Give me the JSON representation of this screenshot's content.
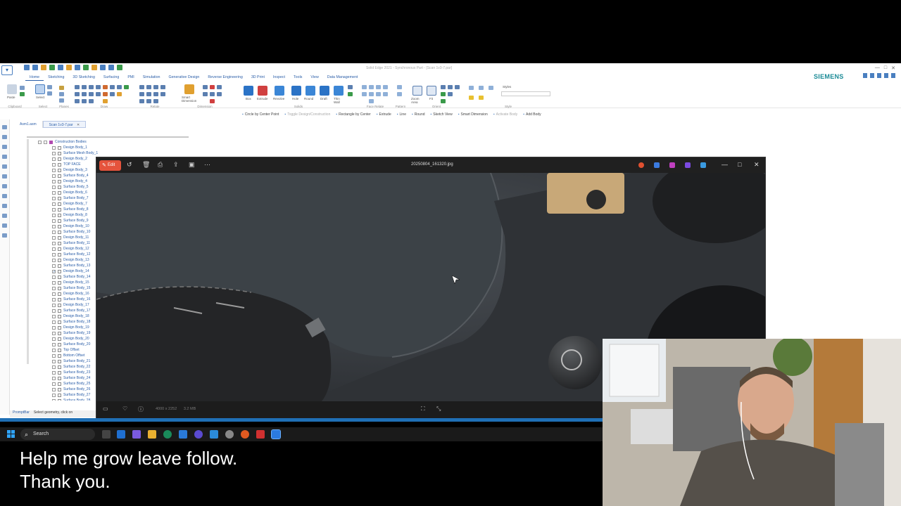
{
  "solid_edge": {
    "window_title": "Solid Edge 2021 - Synchronous Part - [Scan 1v3-7.par]",
    "brand": "SIEMENS",
    "tabs": [
      "Home",
      "Sketching",
      "3D Sketching",
      "Surfacing",
      "PMI",
      "Simulation",
      "Generative Design",
      "Reverse Engineering",
      "3D Print",
      "Inspect",
      "Tools",
      "View",
      "Data Management"
    ],
    "ribbon_groups": [
      "Clipboard",
      "Select",
      "Planes",
      "Draw",
      "Relate",
      "Dimension",
      "Solids",
      "Face Relate",
      "Pattern",
      "Orient",
      "Style"
    ],
    "ribbon_buttons": {
      "paste": "Paste",
      "select": "Select",
      "smart_dimension": "Smart Dimension",
      "box": "Box",
      "extrude": "Extrude",
      "revolve": "Revolve",
      "hole": "Hole",
      "round": "Round",
      "draft": "Draft",
      "thin_wall": "Thin Wall",
      "zoom_area": "Zoom Area",
      "fit": "Fit",
      "styles": "Styles"
    },
    "command_bar": [
      "Circle by Center Point",
      "Toggle Design/Construction",
      "Rectangle by Center",
      "Extrude",
      "Line",
      "Round",
      "Sketch View",
      "Smart Dimension",
      "Activate Body",
      "Add Body"
    ],
    "doc_tabs": [
      "Asm1.asm",
      "Scan 1v3-7.par"
    ],
    "tree": {
      "root": "Construction Bodies",
      "items": [
        "Design Body_1",
        "Surface Mesh Body_1",
        "Design Body_2",
        "TOP FACE",
        "Design Body_3",
        "Surface Body_4",
        "Design Body_4",
        "Surface Body_5",
        "Design Body_6",
        "Surface Body_7",
        "Design Body_7",
        "Surface Body_8",
        "Design Body_8",
        "Surface Body_9",
        "Design Body_10",
        "Surface Body_10",
        "Design Body_11",
        "Surface Body_11",
        "Design Body_12",
        "Surface Body_12",
        "Design Body_13",
        "Surface Body_13",
        "Design Body_14",
        "Surface Body_14",
        "Design Body_15",
        "Surface Body_15",
        "Design Body_16",
        "Surface Body_16",
        "Design Body_17",
        "Surface Body_17",
        "Design Body_18",
        "Surface Body_18",
        "Design Body_19",
        "Surface Body_19",
        "Design Body_20",
        "Surface Body_20",
        "Top Offset",
        "Bottom Offset",
        "Surface Body_21",
        "Surface Body_22",
        "Surface Body_23",
        "Surface Body_24",
        "Surface Body_25",
        "Surface Body_26",
        "Surface Body_27",
        "Surface Body_28"
      ],
      "checked_index": 22
    },
    "prompt_bar": {
      "label": "PromptBar",
      "text": "Select geometry, click on"
    }
  },
  "photo_viewer": {
    "edit_label": "Edit",
    "filename": "20250804_161320.jpg",
    "dimensions": "4000 x 2252",
    "file_size": "3.2 MB"
  },
  "taskbar": {
    "search_placeholder": "Search"
  },
  "caption": {
    "line1": "Help me grow leave follow.",
    "line2": "Thank you."
  },
  "colors": {
    "edit_button": "#e5533c",
    "brand": "#1a8a96",
    "taskbar_accent": "#1f6fb5"
  }
}
